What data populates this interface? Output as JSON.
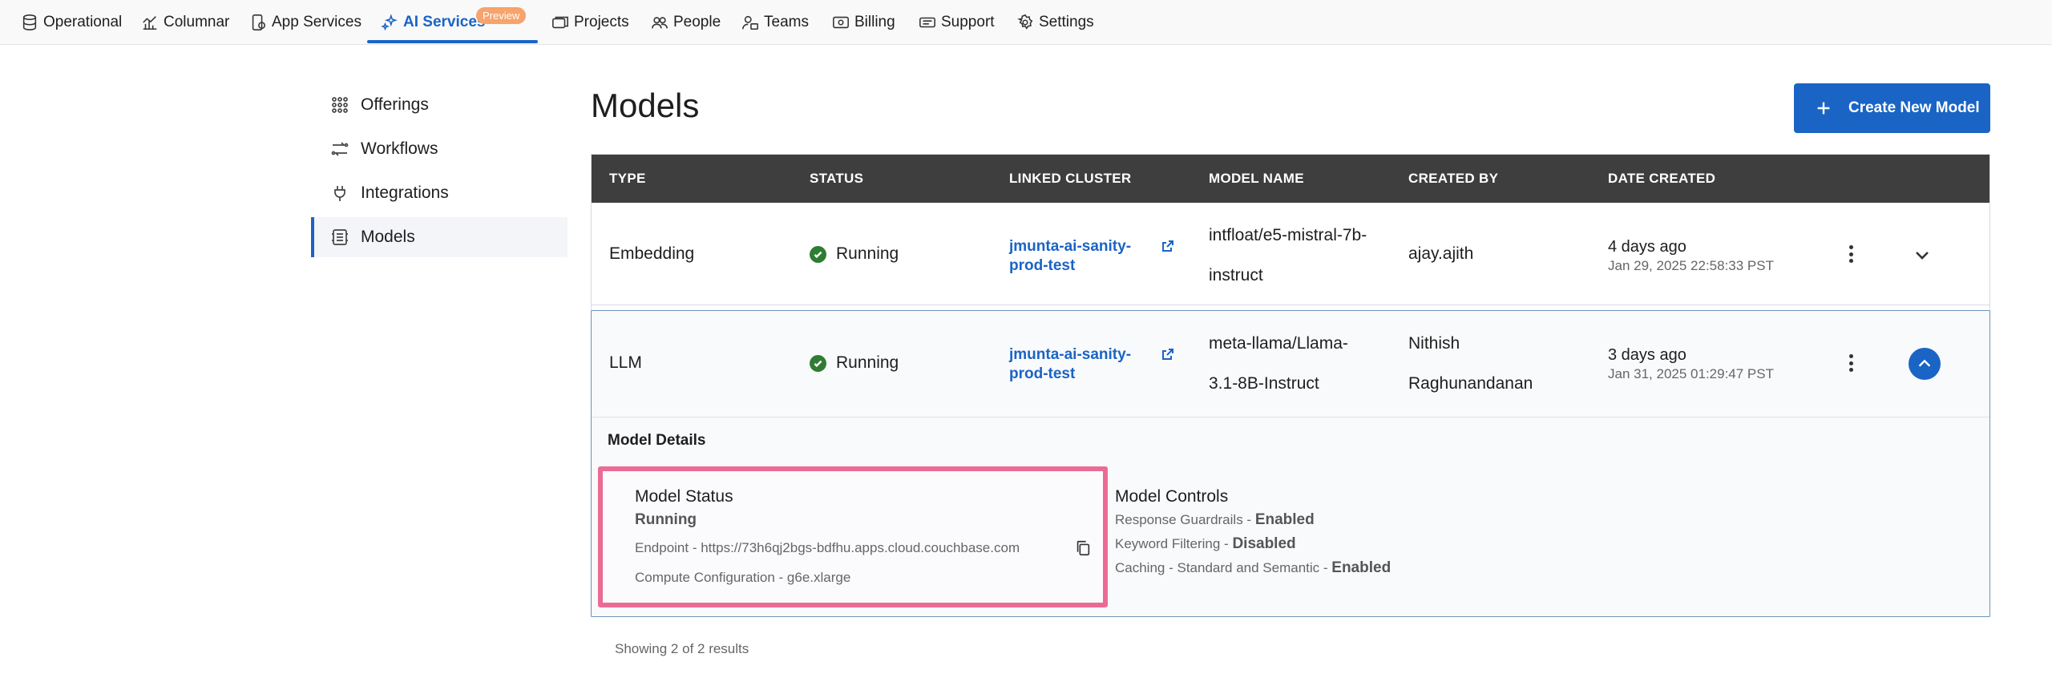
{
  "nav": {
    "items": [
      {
        "label": "Operational",
        "icon": "database-icon"
      },
      {
        "label": "Columnar",
        "icon": "columnar-chart-icon"
      },
      {
        "label": "App Services",
        "icon": "app-services-icon"
      },
      {
        "label": "AI Services",
        "icon": "ai-sparkle-icon",
        "active": true,
        "badge": "Preview"
      },
      {
        "label": "Projects",
        "icon": "projects-icon"
      },
      {
        "label": "People",
        "icon": "people-icon"
      },
      {
        "label": "Teams",
        "icon": "teams-icon"
      },
      {
        "label": "Billing",
        "icon": "billing-icon"
      },
      {
        "label": "Support",
        "icon": "support-icon"
      },
      {
        "label": "Settings",
        "icon": "gear-icon"
      }
    ]
  },
  "sidebar": {
    "items": [
      {
        "label": "Offerings",
        "icon": "grid-icon"
      },
      {
        "label": "Workflows",
        "icon": "workflow-icon"
      },
      {
        "label": "Integrations",
        "icon": "plug-icon"
      },
      {
        "label": "Models",
        "icon": "models-icon",
        "active": true
      }
    ]
  },
  "page": {
    "title": "Models",
    "create_button": "Create New Model"
  },
  "table": {
    "headers": [
      "TYPE",
      "STATUS",
      "LINKED CLUSTER",
      "MODEL NAME",
      "CREATED BY",
      "DATE CREATED"
    ],
    "rows": [
      {
        "type": "Embedding",
        "status": "Running",
        "cluster_line1": "jmunta-ai-sanity-",
        "cluster_line2": "prod-test",
        "model_line1": "intfloat/e5-mistral-7b-",
        "model_line2": "instruct",
        "created_by_line1": "ajay.ajith",
        "created_by_line2": "",
        "date_relative": "4 days ago",
        "date_full": "Jan 29, 2025 22:58:33 PST",
        "expanded": false
      },
      {
        "type": "LLM",
        "status": "Running",
        "cluster_line1": "jmunta-ai-sanity-",
        "cluster_line2": "prod-test",
        "model_line1": "meta-llama/Llama-",
        "model_line2": "3.1-8B-Instruct",
        "created_by_line1": "Nithish",
        "created_by_line2": "Raghunandanan",
        "date_relative": "3 days ago",
        "date_full": "Jan 31, 2025 01:29:47 PST",
        "expanded": true
      }
    ]
  },
  "details": {
    "title": "Model Details",
    "status": {
      "title": "Model Status",
      "value": "Running",
      "endpoint": "Endpoint - https://73h6qj2bgs-bdfhu.apps.cloud.couchbase.com",
      "compute": "Compute Configuration - g6e.xlarge"
    },
    "controls": {
      "title": "Model Controls",
      "items": [
        {
          "label": "Response Guardrails - ",
          "value": "Enabled"
        },
        {
          "label": "Keyword Filtering - ",
          "value": "Disabled"
        },
        {
          "label": "Caching - Standard and Semantic - ",
          "value": "Enabled"
        }
      ]
    }
  },
  "footer": {
    "results": "Showing 2 of 2 results"
  },
  "colors": {
    "accent": "#1a64c5",
    "header_bg": "#3e3e3e",
    "running_green": "#2e7d32",
    "highlight": "#ec6b94",
    "preview_badge": "#f6a46b"
  }
}
